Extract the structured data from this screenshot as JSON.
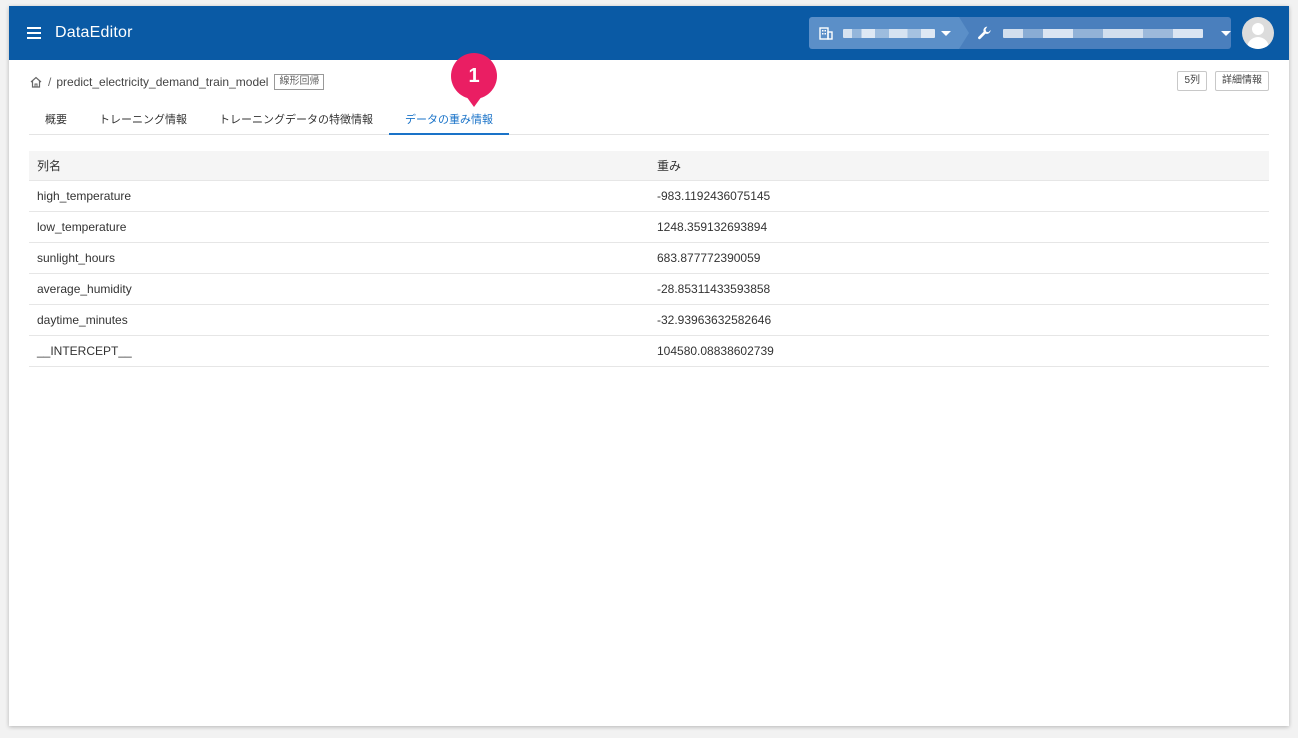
{
  "header": {
    "app_title": "DataEditor",
    "menu_icon": "hamburger-menu-icon",
    "org_icon": "building-icon",
    "project_icon": "wrench-icon",
    "colors": {
      "bar": "#0a5aa5",
      "accent": "#1a73c8",
      "badge": "#ea1e63"
    }
  },
  "breadcrumb": {
    "separator": "/",
    "model_name": "predict_electricity_demand_train_model",
    "model_type": "線形回帰"
  },
  "actions": {
    "columns_label": "5列",
    "details_label": "詳細情報"
  },
  "tabs": [
    {
      "label": "概要",
      "active": false
    },
    {
      "label": "トレーニング情報",
      "active": false
    },
    {
      "label": "トレーニングデータの特徴情報",
      "active": false
    },
    {
      "label": "データの重み情報",
      "active": true
    }
  ],
  "annotation": {
    "number": "1"
  },
  "table": {
    "headers": [
      "列名",
      "重み"
    ],
    "rows": [
      [
        "high_temperature",
        "-983.1192436075145"
      ],
      [
        "low_temperature",
        "1248.359132693894"
      ],
      [
        "sunlight_hours",
        "683.877772390059"
      ],
      [
        "average_humidity",
        "-28.85311433593858"
      ],
      [
        "daytime_minutes",
        "-32.93963632582646"
      ],
      [
        "__INTERCEPT__",
        "104580.08838602739"
      ]
    ]
  }
}
